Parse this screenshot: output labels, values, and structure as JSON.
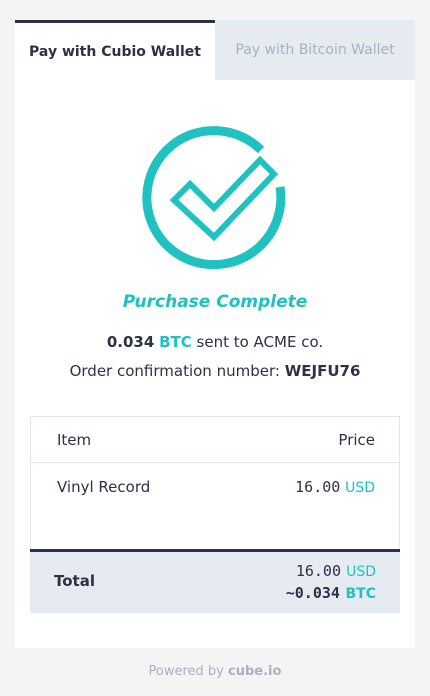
{
  "tabs": {
    "active": "Pay with Cubio Wallet",
    "inactive": "Pay with Bitcoin Wallet"
  },
  "status": {
    "icon": "checkmark-circle-icon",
    "title": "Purchase Complete",
    "amount": "0.034",
    "currency": "BTC",
    "sent_text": "sent to ACME co.",
    "confirmation_label": "Order confirmation number:",
    "confirmation_number": "WEJFU76"
  },
  "table": {
    "headers": {
      "item": "Item",
      "price": "Price"
    },
    "rows": [
      {
        "name": "Vinyl Record",
        "price": "16.00",
        "unit": "USD"
      }
    ],
    "total": {
      "label": "Total",
      "usd_value": "16.00",
      "usd_unit": "USD",
      "btc_value": "~0.034",
      "btc_unit": "BTC"
    }
  },
  "footer": {
    "powered_by": "Powered by",
    "brand": "cube.io"
  },
  "colors": {
    "accent": "#1fc2c0",
    "dark": "#2d3047",
    "muted": "#a5b2c3",
    "panel": "#e6ebf1"
  }
}
